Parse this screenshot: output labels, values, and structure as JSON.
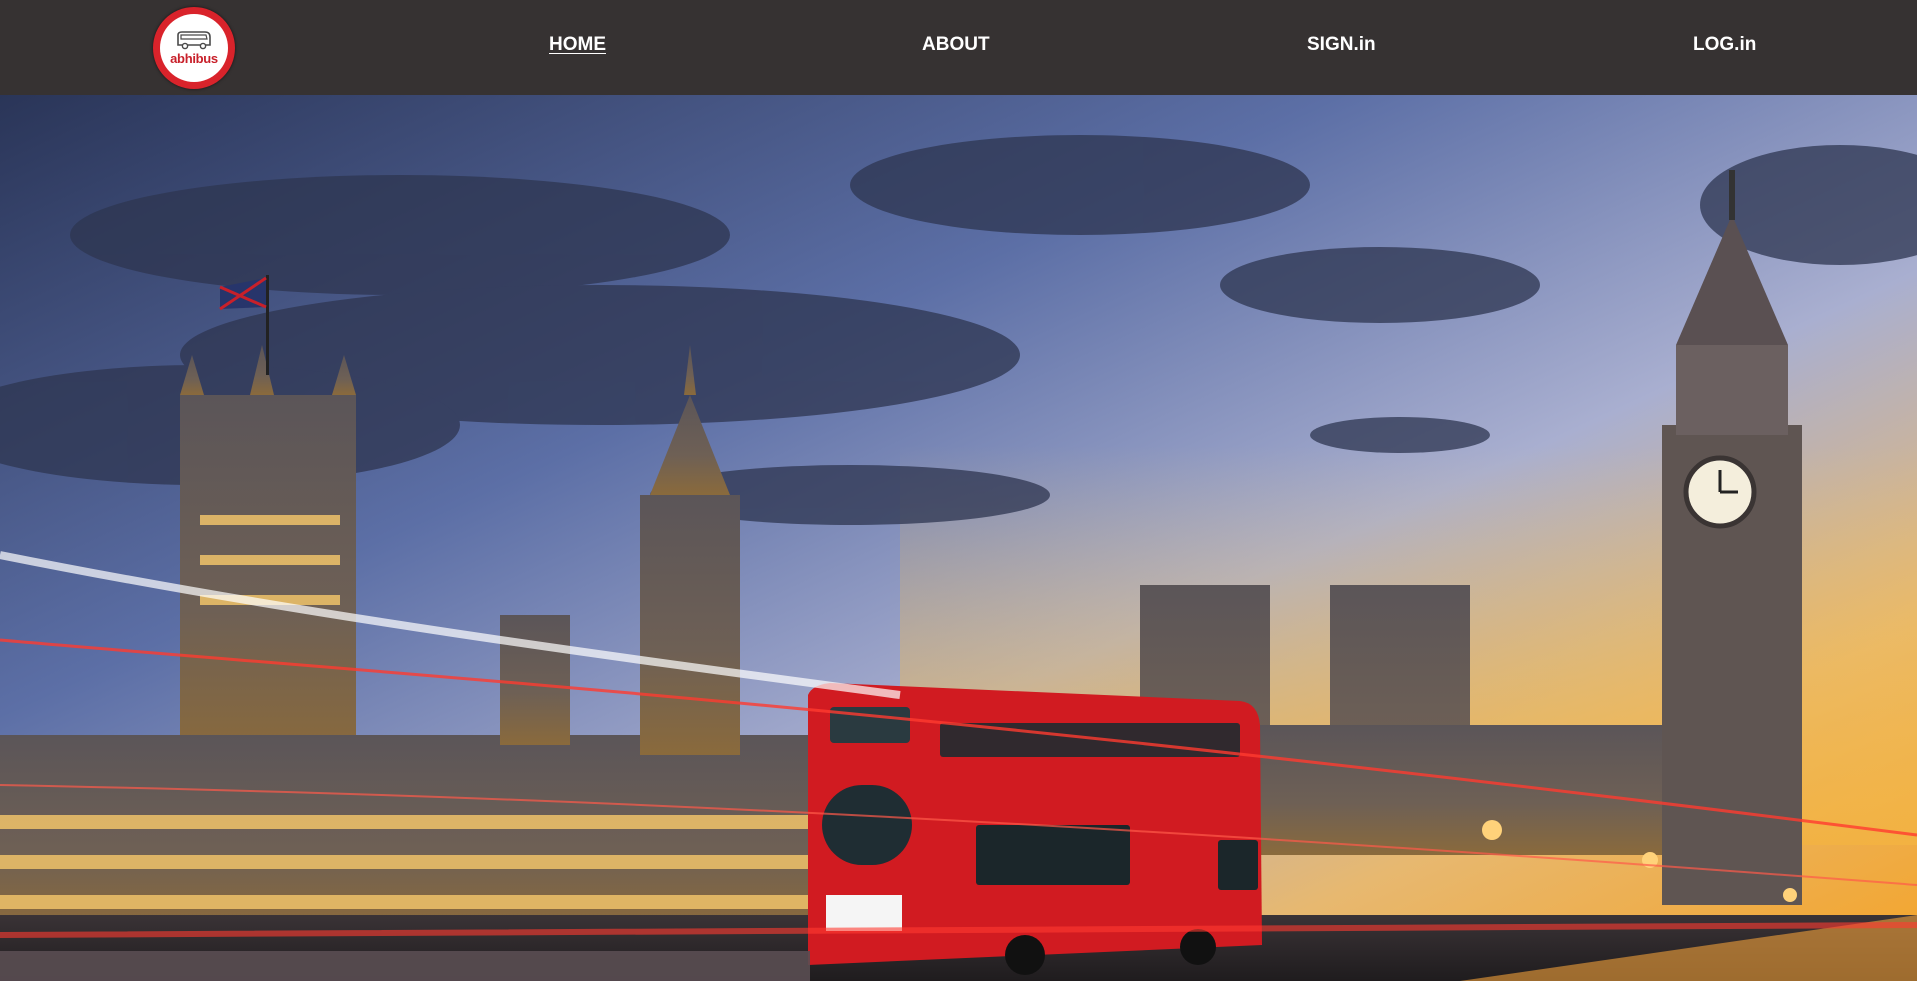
{
  "brand": {
    "logo_text": "abhibus",
    "logo_icon": "bus-icon",
    "colors": {
      "logo_red": "#d9232b",
      "nav_background": "#363232",
      "nav_text": "#ffffff"
    }
  },
  "nav": {
    "items": [
      {
        "label": "HOME",
        "active": true
      },
      {
        "label": "ABOUT",
        "active": false
      },
      {
        "label": "SIGN.in",
        "active": false
      },
      {
        "label": "LOG.in",
        "active": false
      }
    ]
  },
  "hero": {
    "image_subject": "london-westminster-big-ben-red-bus-hero"
  }
}
